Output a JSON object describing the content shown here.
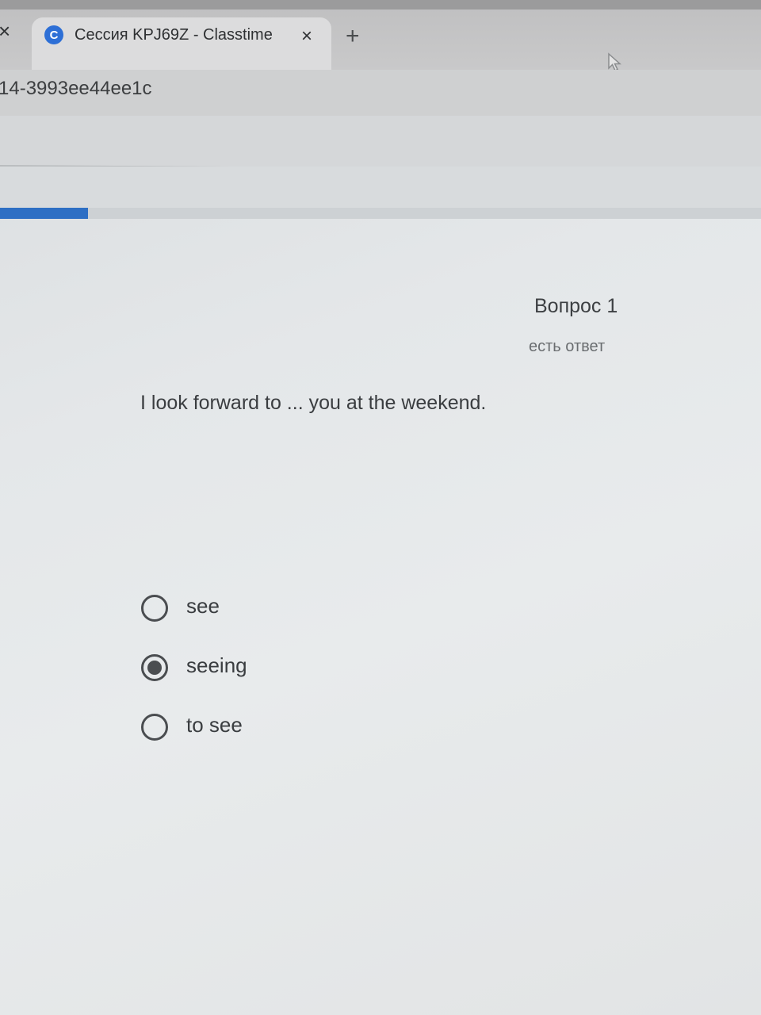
{
  "browser": {
    "prev_tab_close": "×",
    "tab": {
      "favicon_letter": "C",
      "title": "Сессия KPJ69Z - Classtime",
      "close": "×"
    },
    "new_tab": "+",
    "url_fragment": "14-3993ee44ee1c"
  },
  "quiz": {
    "progress_fraction": 0.116,
    "accent_color": "#2e6fc4",
    "question_number": "Вопрос 1",
    "answer_status": "есть ответ",
    "question_text": "I look forward to ... you at the weekend.",
    "options": [
      {
        "label": "see",
        "selected": false
      },
      {
        "label": "seeing",
        "selected": true
      },
      {
        "label": "to see",
        "selected": false
      }
    ]
  }
}
